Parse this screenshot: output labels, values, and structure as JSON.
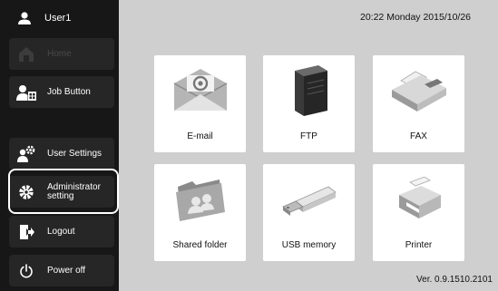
{
  "user": {
    "name": "User1",
    "icon": "person-icon"
  },
  "sidebar": {
    "items": [
      {
        "label": "Home",
        "icon": "home-icon",
        "enabled": false
      },
      {
        "label": "Job Button",
        "icon": "job-button-icon",
        "enabled": true
      },
      {
        "label": "User Settings",
        "icon": "user-settings-icon",
        "enabled": true
      },
      {
        "label_line1": "Administrator",
        "label_line2": "setting",
        "icon": "gear-icon",
        "enabled": true,
        "highlighted": true
      },
      {
        "label": "Logout",
        "icon": "logout-icon",
        "enabled": true
      },
      {
        "label": "Power off",
        "icon": "power-icon",
        "enabled": true
      }
    ]
  },
  "header": {
    "datetime": "20:22 Monday 2015/10/26"
  },
  "tiles": [
    {
      "label": "E-mail",
      "icon": "email-envelope-icon"
    },
    {
      "label": "FTP",
      "icon": "ftp-server-icon"
    },
    {
      "label": "FAX",
      "icon": "fax-machine-icon"
    },
    {
      "label": "Shared folder",
      "icon": "shared-folder-icon"
    },
    {
      "label": "USB memory",
      "icon": "usb-memory-icon"
    },
    {
      "label": "Printer",
      "icon": "printer-icon"
    }
  ],
  "footer": {
    "version": "Ver. 0.9.1510.2101"
  },
  "colors": {
    "sidebar_bg": "#171717",
    "button_bg": "#262626",
    "main_bg": "#cfcfcf",
    "tile_bg": "#ffffff",
    "highlight": "#ffffff"
  }
}
